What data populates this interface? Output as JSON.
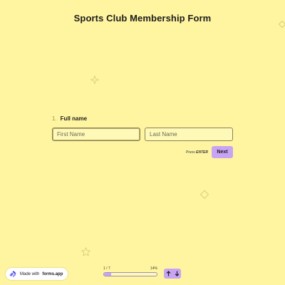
{
  "form": {
    "title": "Sports Club Membership Form"
  },
  "question": {
    "number": "1.",
    "label": "Full name",
    "first_name_placeholder": "First Name",
    "last_name_placeholder": "Last Name"
  },
  "actions": {
    "press_prefix": "Press",
    "press_key": "ENTER",
    "next_label": "Next"
  },
  "progress": {
    "step_text": "1 / 7",
    "percent_text": "14%",
    "fraction": 0.14
  },
  "badge": {
    "prefix": "Made with",
    "brand": "forms.app"
  },
  "colors": {
    "background": "#fff5a0",
    "accent": "#c9a4f5",
    "field_bg": "#fff9b8",
    "field_border": "#8a8258"
  },
  "icons": {
    "brand_logo": "forms-app-logo-icon",
    "up": "arrow-up-icon",
    "down": "arrow-down-icon",
    "decorations": [
      "diamond-outline-icon",
      "sparkle-outline-icon",
      "star-outline-icon"
    ]
  }
}
